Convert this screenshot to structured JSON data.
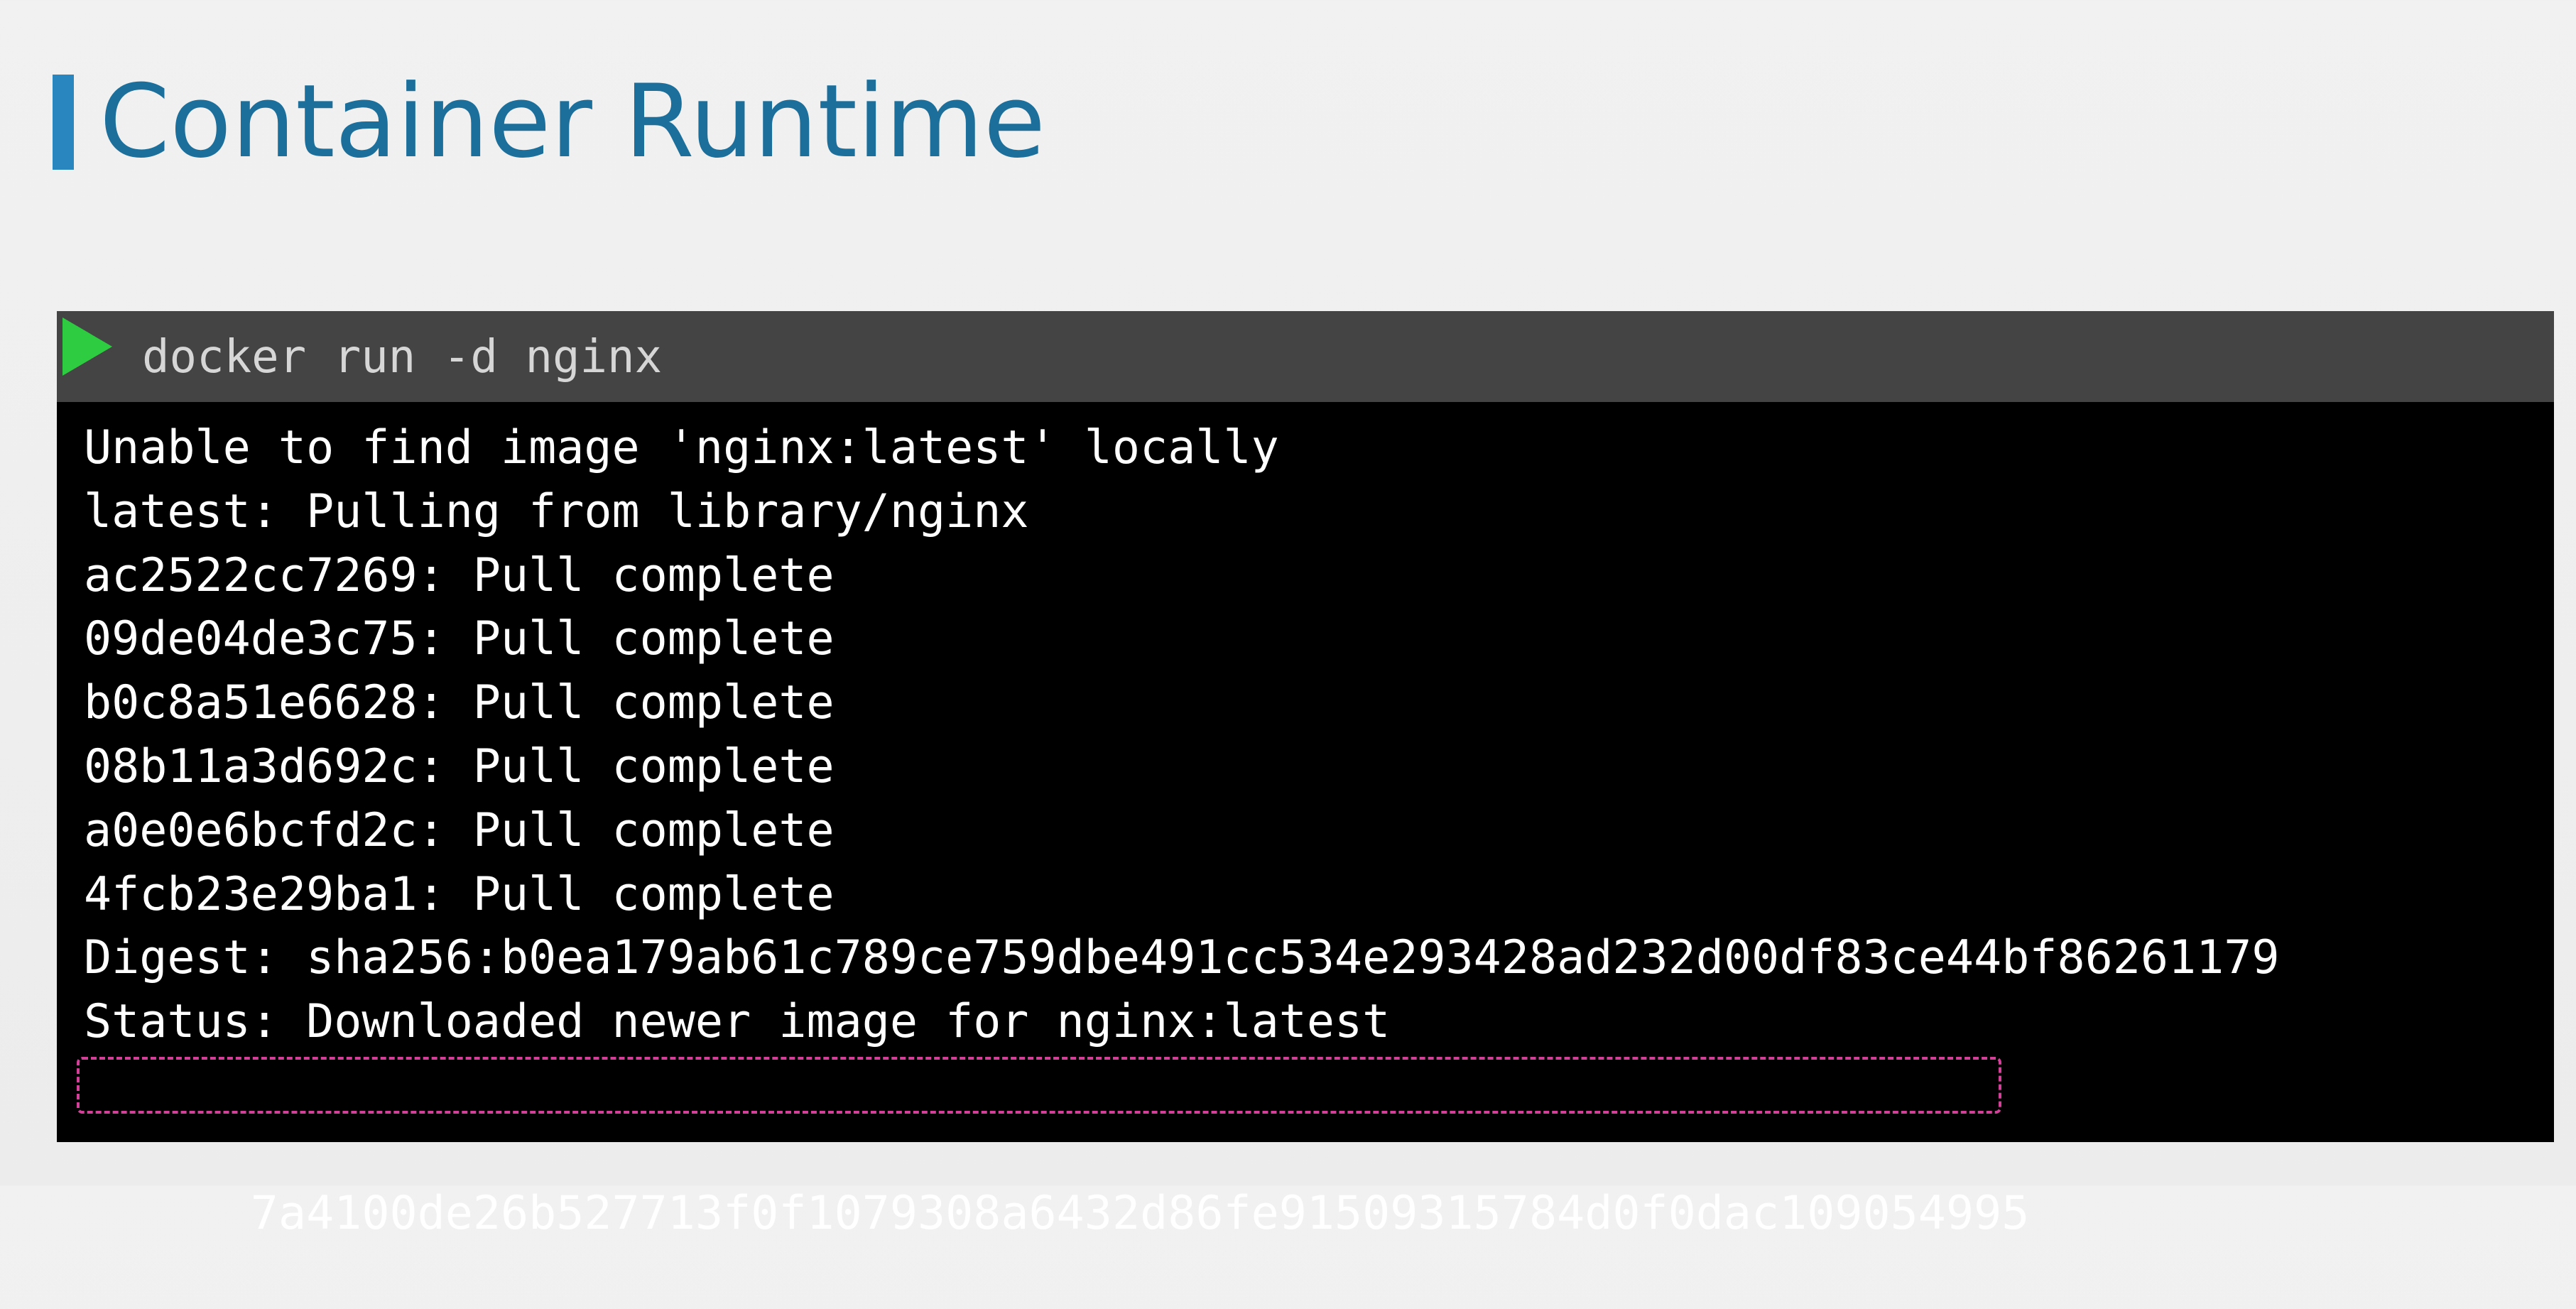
{
  "slide": {
    "title": "Container Runtime",
    "accent_color": "#2a86bf",
    "title_color": "#1c6f9b"
  },
  "terminal": {
    "prompt_icon": "play-icon",
    "prompt_icon_color": "#2ecc40",
    "command": "docker run -d nginx",
    "output_lines": [
      "Unable to find image 'nginx:latest' locally",
      "latest: Pulling from library/nginx",
      "ac2522cc7269: Pull complete",
      "09de04de3c75: Pull complete",
      "b0c8a51e6628: Pull complete",
      "08b11a3d692c: Pull complete",
      "a0e0e6bcfd2c: Pull complete",
      "4fcb23e29ba1: Pull complete",
      "Digest: sha256:b0ea179ab61c789ce759dbe491cc534e293428ad232d00df83ce44bf86261179",
      "Status: Downloaded newer image for nginx:latest",
      "7a4100de26b527713f0f1079308a6432d86fe91509315784d0f0dac109054995"
    ],
    "highlighted_line_index": 10,
    "highlight_color": "#d43f9a"
  }
}
